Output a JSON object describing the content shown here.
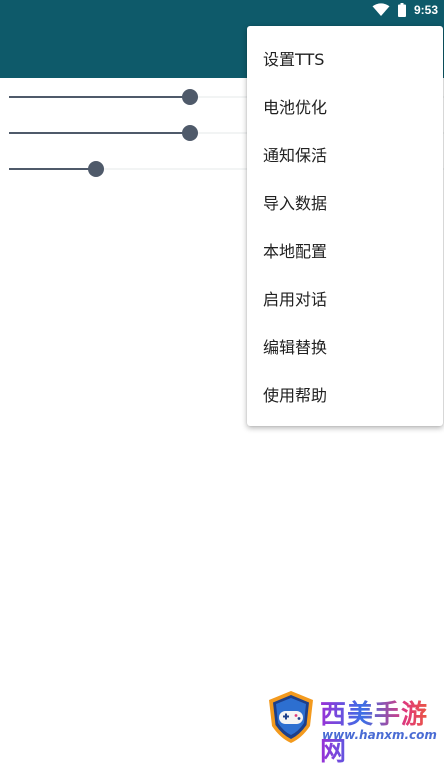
{
  "status_bar": {
    "time": "9:53",
    "icons": [
      "wifi-icon",
      "battery-icon"
    ]
  },
  "sliders": [
    {
      "level": 0.44
    },
    {
      "level": 0.44
    },
    {
      "level": 0.21
    }
  ],
  "menu": {
    "items": [
      "设置TTS",
      "电池优化",
      "通知保活",
      "导入数据",
      "本地配置",
      "启用对话",
      "编辑替换",
      "使用帮助"
    ]
  },
  "watermark": {
    "title": "西美手游网",
    "url": "www.hanxm.com"
  },
  "colors": {
    "toolbar": "#0e5a6a",
    "slider": "#4f5a6a"
  }
}
